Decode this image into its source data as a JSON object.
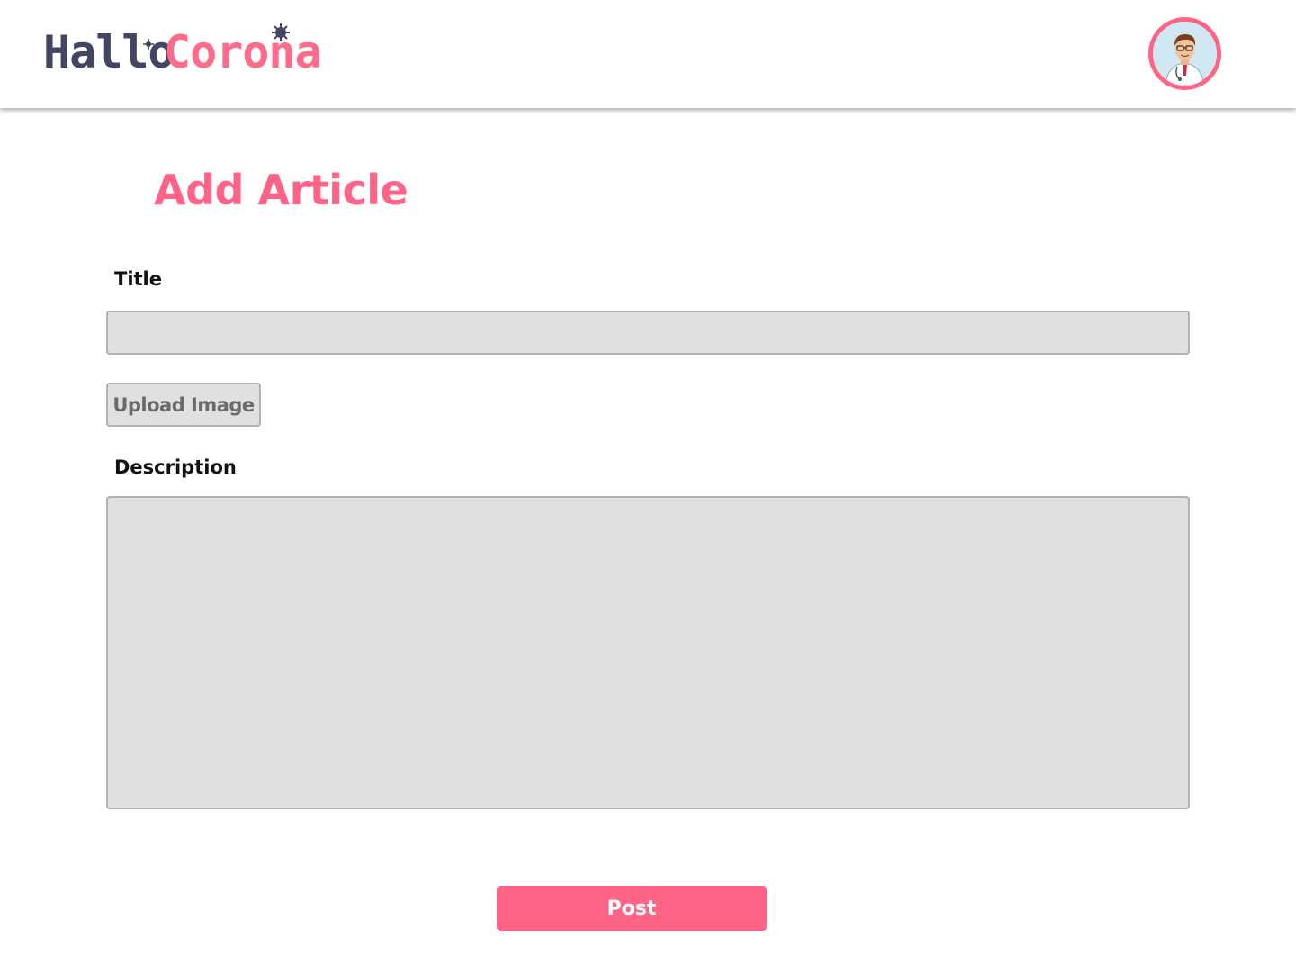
{
  "header": {
    "logo_part1": "Hallo",
    "logo_part2": "Corona",
    "avatar_icon": "doctor-avatar-icon"
  },
  "page": {
    "title": "Add Article"
  },
  "form": {
    "title_label": "Title",
    "title_value": "",
    "upload_label": "Upload Image",
    "description_label": "Description",
    "description_value": "",
    "post_label": "Post"
  },
  "colors": {
    "accent": "#ff6487",
    "logo_dark": "#434662",
    "input_bg": "#e0e0e0",
    "input_border": "#b1b1b1"
  }
}
